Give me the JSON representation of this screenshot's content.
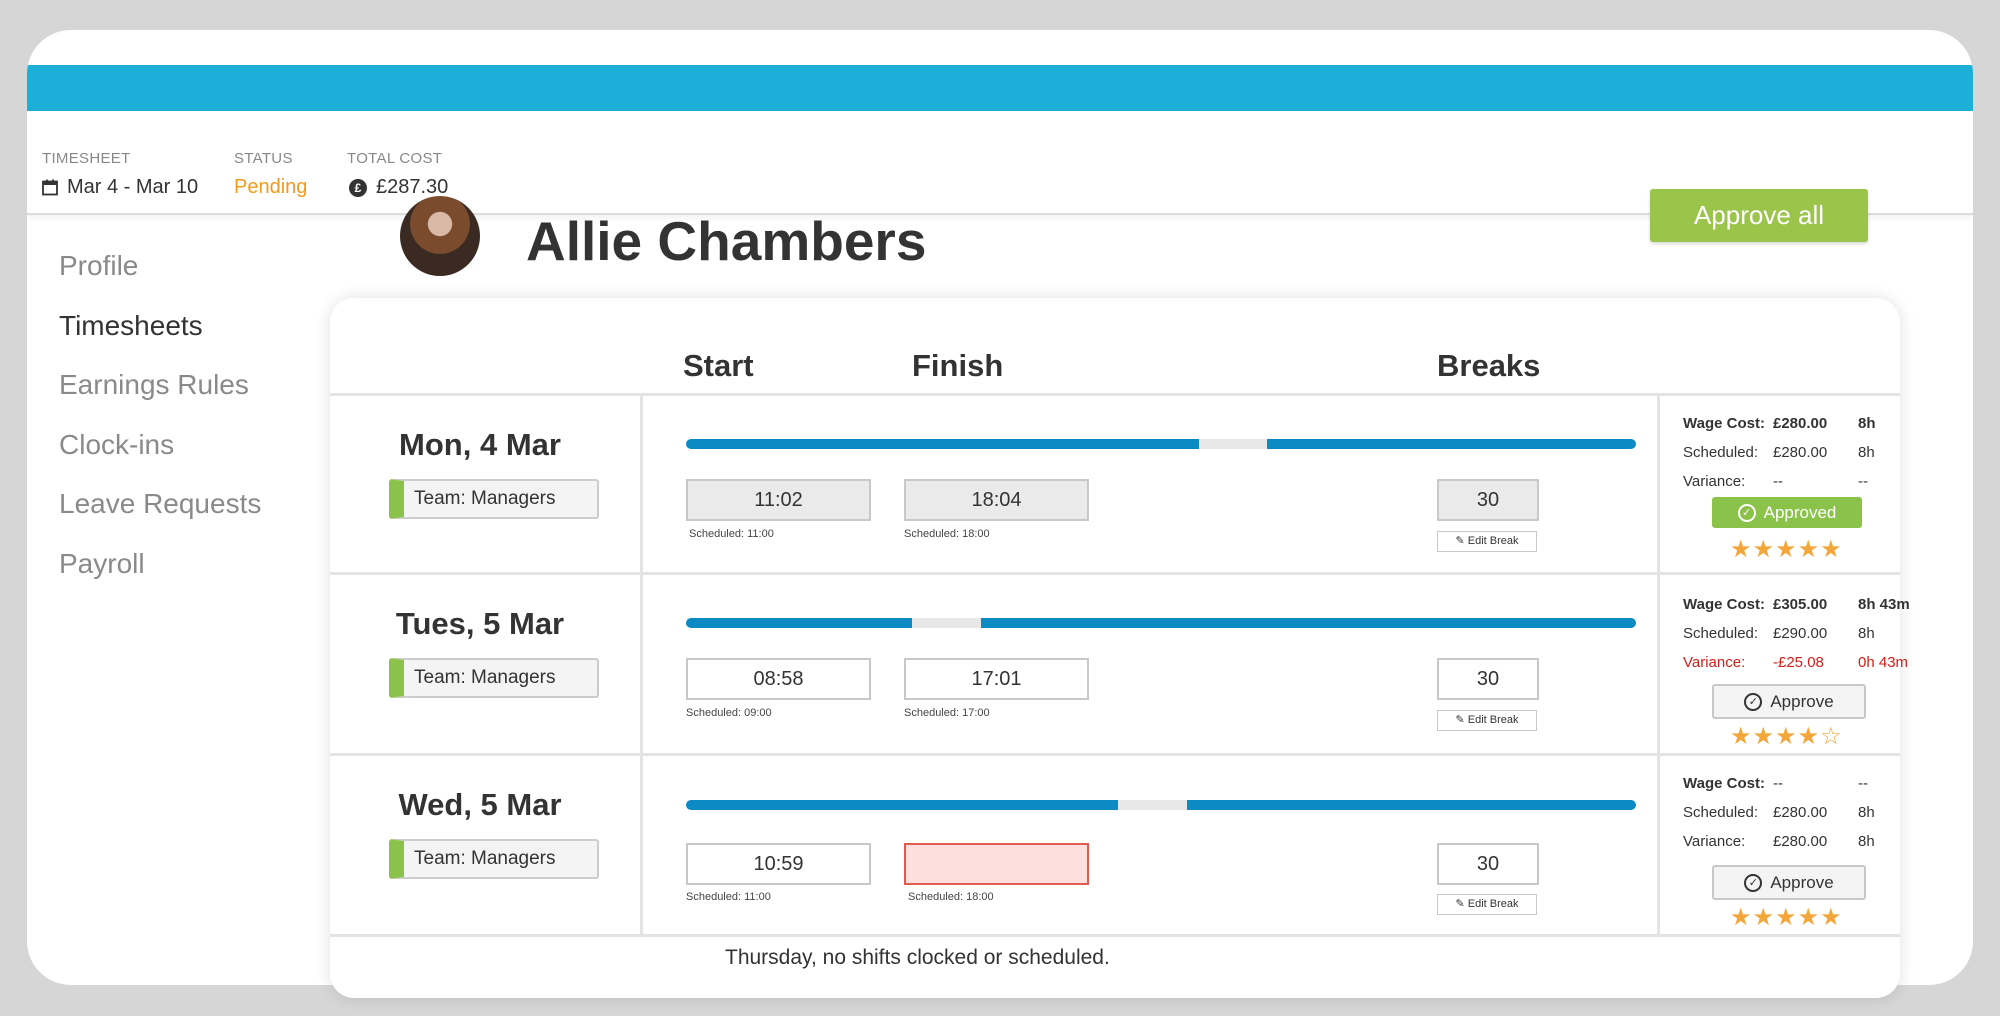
{
  "summary": {
    "timesheet_caption": "TIMESHEET",
    "timesheet_range": "Mar 4 - Mar 10",
    "status_caption": "STATUS",
    "status_value": "Pending",
    "cost_caption": "TOTAL COST",
    "cost_value": "£287.30"
  },
  "sidebar": {
    "items": [
      {
        "label": "Profile"
      },
      {
        "label": "Timesheets"
      },
      {
        "label": "Earnings Rules"
      },
      {
        "label": "Clock-ins"
      },
      {
        "label": "Leave Requests"
      },
      {
        "label": "Payroll"
      }
    ]
  },
  "employee": {
    "name": "Allie Chambers"
  },
  "actions": {
    "approve_all": "Approve all"
  },
  "columns": {
    "start": "Start",
    "finish": "Finish",
    "breaks": "Breaks"
  },
  "days": [
    {
      "day": "Mon, 4 Mar",
      "team": "Team: Managers",
      "start": "11:02",
      "start_scheduled": "Scheduled: 11:00",
      "finish": "18:04",
      "finish_scheduled": "Scheduled: 18:00",
      "breaks": "30",
      "edit_break": "Edit Break",
      "wage_cost_label": "Wage Cost:",
      "wage_cost": "£280.00",
      "wage_hours": "8h",
      "scheduled_label": "Scheduled:",
      "scheduled_cost": "£280.00",
      "scheduled_hours": "8h",
      "variance_label": "Variance:",
      "variance_cost": "--",
      "variance_hours": "--",
      "status": "Approved",
      "rating": 5
    },
    {
      "day": "Tues, 5 Mar",
      "team": "Team: Managers",
      "start": "08:58",
      "start_scheduled": "Scheduled: 09:00",
      "finish": "17:01",
      "finish_scheduled": "Scheduled: 17:00",
      "breaks": "30",
      "edit_break": "Edit Break",
      "wage_cost_label": "Wage Cost:",
      "wage_cost": "£305.00",
      "wage_hours": "8h 43m",
      "scheduled_label": "Scheduled:",
      "scheduled_cost": "£290.00",
      "scheduled_hours": "8h",
      "variance_label": "Variance:",
      "variance_cost": "-£25.08",
      "variance_hours": "0h 43m",
      "status": "Approve",
      "rating": 4
    },
    {
      "day": "Wed, 5 Mar",
      "team": "Team: Managers",
      "start": "10:59",
      "start_scheduled": "Scheduled: 11:00",
      "finish": "",
      "finish_scheduled": "Scheduled: 18:00",
      "breaks": "30",
      "edit_break": "Edit Break",
      "wage_cost_label": "Wage Cost:",
      "wage_cost": "--",
      "wage_hours": "--",
      "scheduled_label": "Scheduled:",
      "scheduled_cost": "£280.00",
      "scheduled_hours": "8h",
      "variance_label": "Variance:",
      "variance_cost": "£280.00",
      "variance_hours": "8h",
      "status": "Approve",
      "rating": 5
    }
  ],
  "footer_note": "Thursday, no shifts clocked or scheduled.",
  "colors": {
    "header_bar": "#1cb0d9",
    "approve_green": "#9bc44b",
    "pending_orange": "#f29a1d",
    "timeline_blue": "#0b8ac4",
    "star_orange": "#f3a73b",
    "variance_red": "#d0201a"
  }
}
